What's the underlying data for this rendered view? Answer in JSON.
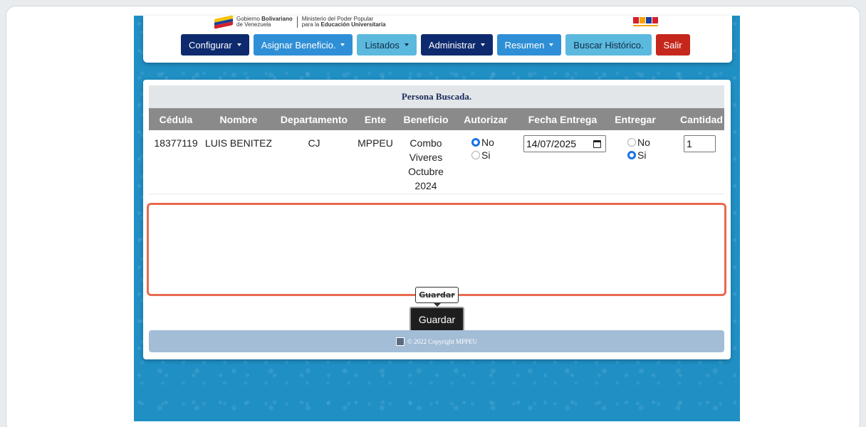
{
  "colors": {
    "stage_bg": "#1f8fc4",
    "nav_dark": "#0e2a6e",
    "nav_blue": "#2f8fd6",
    "nav_light": "#5bb9de",
    "nav_red": "#c5271c",
    "highlight": "#e86a4e"
  },
  "header": {
    "gov_line1": "Gobierno",
    "gov_line1_bold": "Bolivariano",
    "gov_line2": "de Venezuela",
    "ministry_line1": "Ministerio del Poder Popular",
    "ministry_line2": "para la",
    "ministry_line2_bold": "Educación Universitaria",
    "nav": [
      {
        "label": "Configurar",
        "dropdown": true
      },
      {
        "label": "Asignar Beneficio.",
        "dropdown": true
      },
      {
        "label": "Listados",
        "dropdown": true
      },
      {
        "label": "Administrar",
        "dropdown": true
      },
      {
        "label": "Resumen",
        "dropdown": true
      },
      {
        "label": "Buscar Histórico.",
        "dropdown": false
      },
      {
        "label": "Salir",
        "dropdown": false
      }
    ]
  },
  "table": {
    "title": "Persona Buscada.",
    "columns": [
      "Cédula",
      "Nombre",
      "Departamento",
      "Ente",
      "Beneficio",
      "Autorizar",
      "Fecha Entrega",
      "Entregar",
      "Cantidad"
    ],
    "rows": [
      {
        "cedula": "18377119",
        "nombre": "LUIS BENITEZ",
        "departamento": "CJ",
        "ente": "MPPEU",
        "beneficio_lines": [
          "Combo",
          "Viveres",
          "Octubre",
          "2024"
        ],
        "autorizar": {
          "options": [
            "No",
            "Si"
          ],
          "selected": "No"
        },
        "fecha_entrega": "14/07/2025",
        "entregar": {
          "options": [
            "No",
            "Si"
          ],
          "selected": "Si"
        },
        "cantidad": "1"
      }
    ]
  },
  "actions": {
    "tooltip": "Guardar",
    "save_label": "Guardar"
  },
  "footer": {
    "text": "© 2022 Copyright MPPEU"
  }
}
